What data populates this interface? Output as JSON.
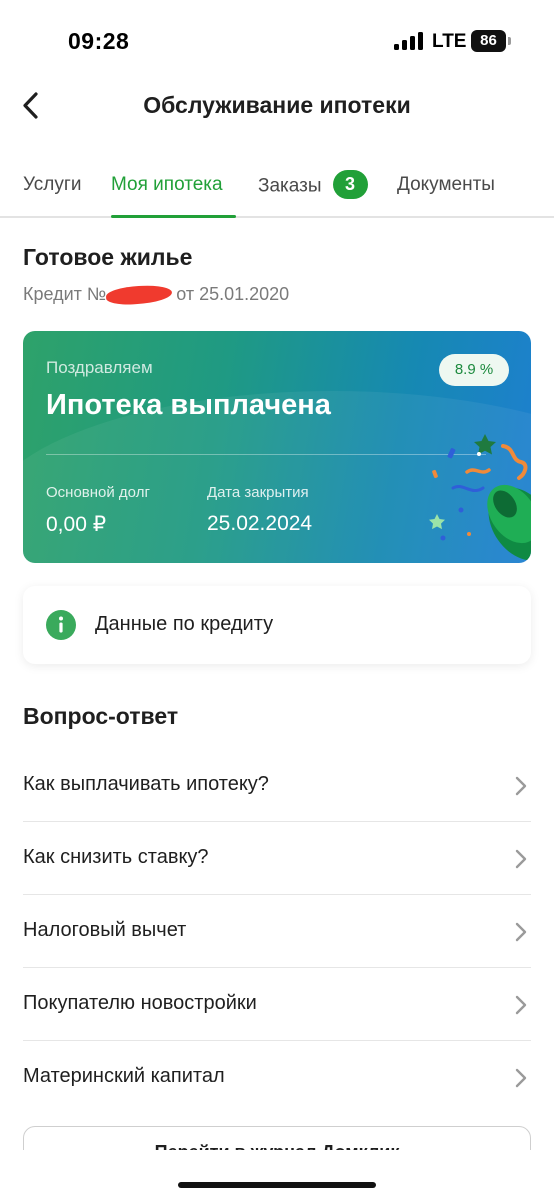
{
  "status": {
    "time": "09:28",
    "network": "LTE",
    "battery": "86"
  },
  "nav": {
    "title": "Обслуживание ипотеки"
  },
  "tabs": [
    {
      "label": "Услуги"
    },
    {
      "label": "Моя ипотека",
      "active": true
    },
    {
      "label": "Заказы",
      "badge": "3"
    },
    {
      "label": "Документы"
    }
  ],
  "product": {
    "title": "Готовое жилье",
    "credit_prefix": "Кредит №",
    "credit_date": "от 25.01.2020"
  },
  "hero": {
    "kicker": "Поздравляем",
    "title": "Ипотека выплачена",
    "rate": "8.9 %",
    "debt_label": "Основной долг",
    "debt_value": "0,00 ₽",
    "close_label": "Дата закрытия",
    "close_value": "25.02.2024"
  },
  "credit_data": {
    "label": "Данные по кредиту"
  },
  "faq": {
    "title": "Вопрос-ответ",
    "items": [
      "Как выплачивать ипотеку?",
      "Как снизить ставку?",
      "Налоговый вычет",
      "Покупателю новостройки",
      "Материнский капитал"
    ]
  },
  "bottom_button": {
    "label": "Перейти в журнал Домклик"
  },
  "colors": {
    "accent": "#21a038",
    "hero_start": "#2ea26a",
    "hero_end": "#1e7fd1"
  }
}
